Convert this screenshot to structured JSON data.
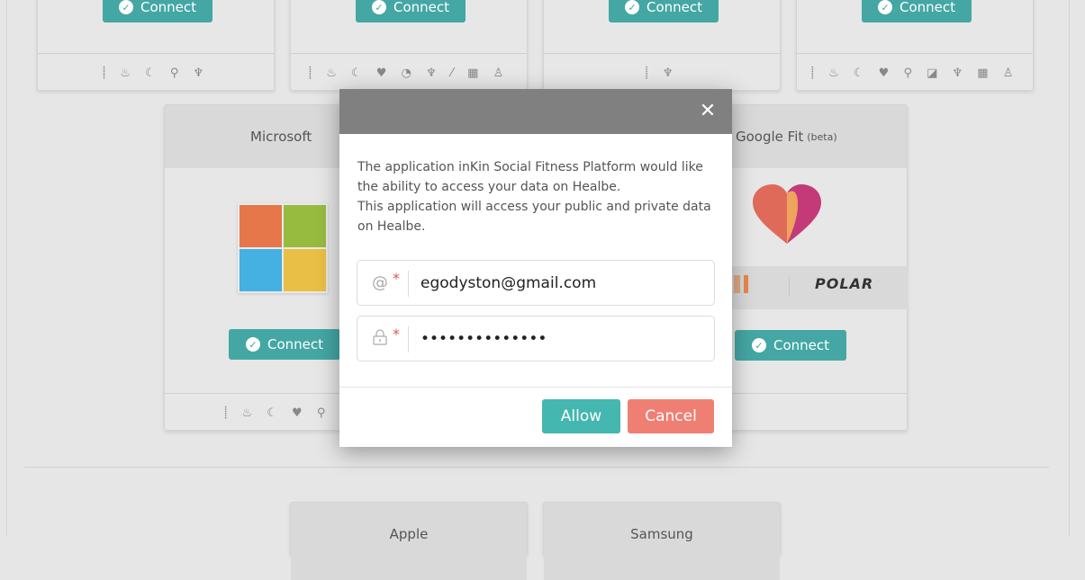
{
  "top_cards": [
    {
      "connect_label": "Connect",
      "metrics": "⸽ ♨ ☾ ⚲ ♆"
    },
    {
      "connect_label": "Connect",
      "metrics": "⸽ ♨ ☾ ♥ ◔ ♆ ⁄ ▦ ♙"
    },
    {
      "connect_label": "Connect",
      "metrics": "⸽ ♆"
    },
    {
      "connect_label": "Connect",
      "metrics": "⸽ ♨ ☾ ♥ ⚲ ◪ ♆ ▦ ♙"
    }
  ],
  "middle_cards": [
    {
      "title": "Microsoft",
      "connect_label": "Connect",
      "metrics": "⸽ ♨ ☾ ♥ ⚲ ♆"
    },
    {
      "title": "Google Fit",
      "title_suffix": "(beta)",
      "connect_label": "Connect",
      "brand": "POLAR"
    }
  ],
  "bottom_cards": [
    {
      "title": "Apple"
    },
    {
      "title": "Samsung"
    }
  ],
  "modal": {
    "close_symbol": "✕",
    "description_line1": "The application inKin Social Fitness Platform would like the ability to access your data on Healbe.",
    "description_line2": "This application will access your public and private data on Healbe.",
    "email_icon": "@",
    "password_icon": "🔒",
    "required_mark": "*",
    "email_value": "egodyston@gmail.com",
    "password_value": "••••••••••••••",
    "allow_label": "Allow",
    "cancel_label": "Cancel"
  },
  "colors": {
    "accent_teal": "#44a7a4",
    "allow": "#44b7b0",
    "cancel": "#f07f73",
    "modal_header": "#808080"
  }
}
